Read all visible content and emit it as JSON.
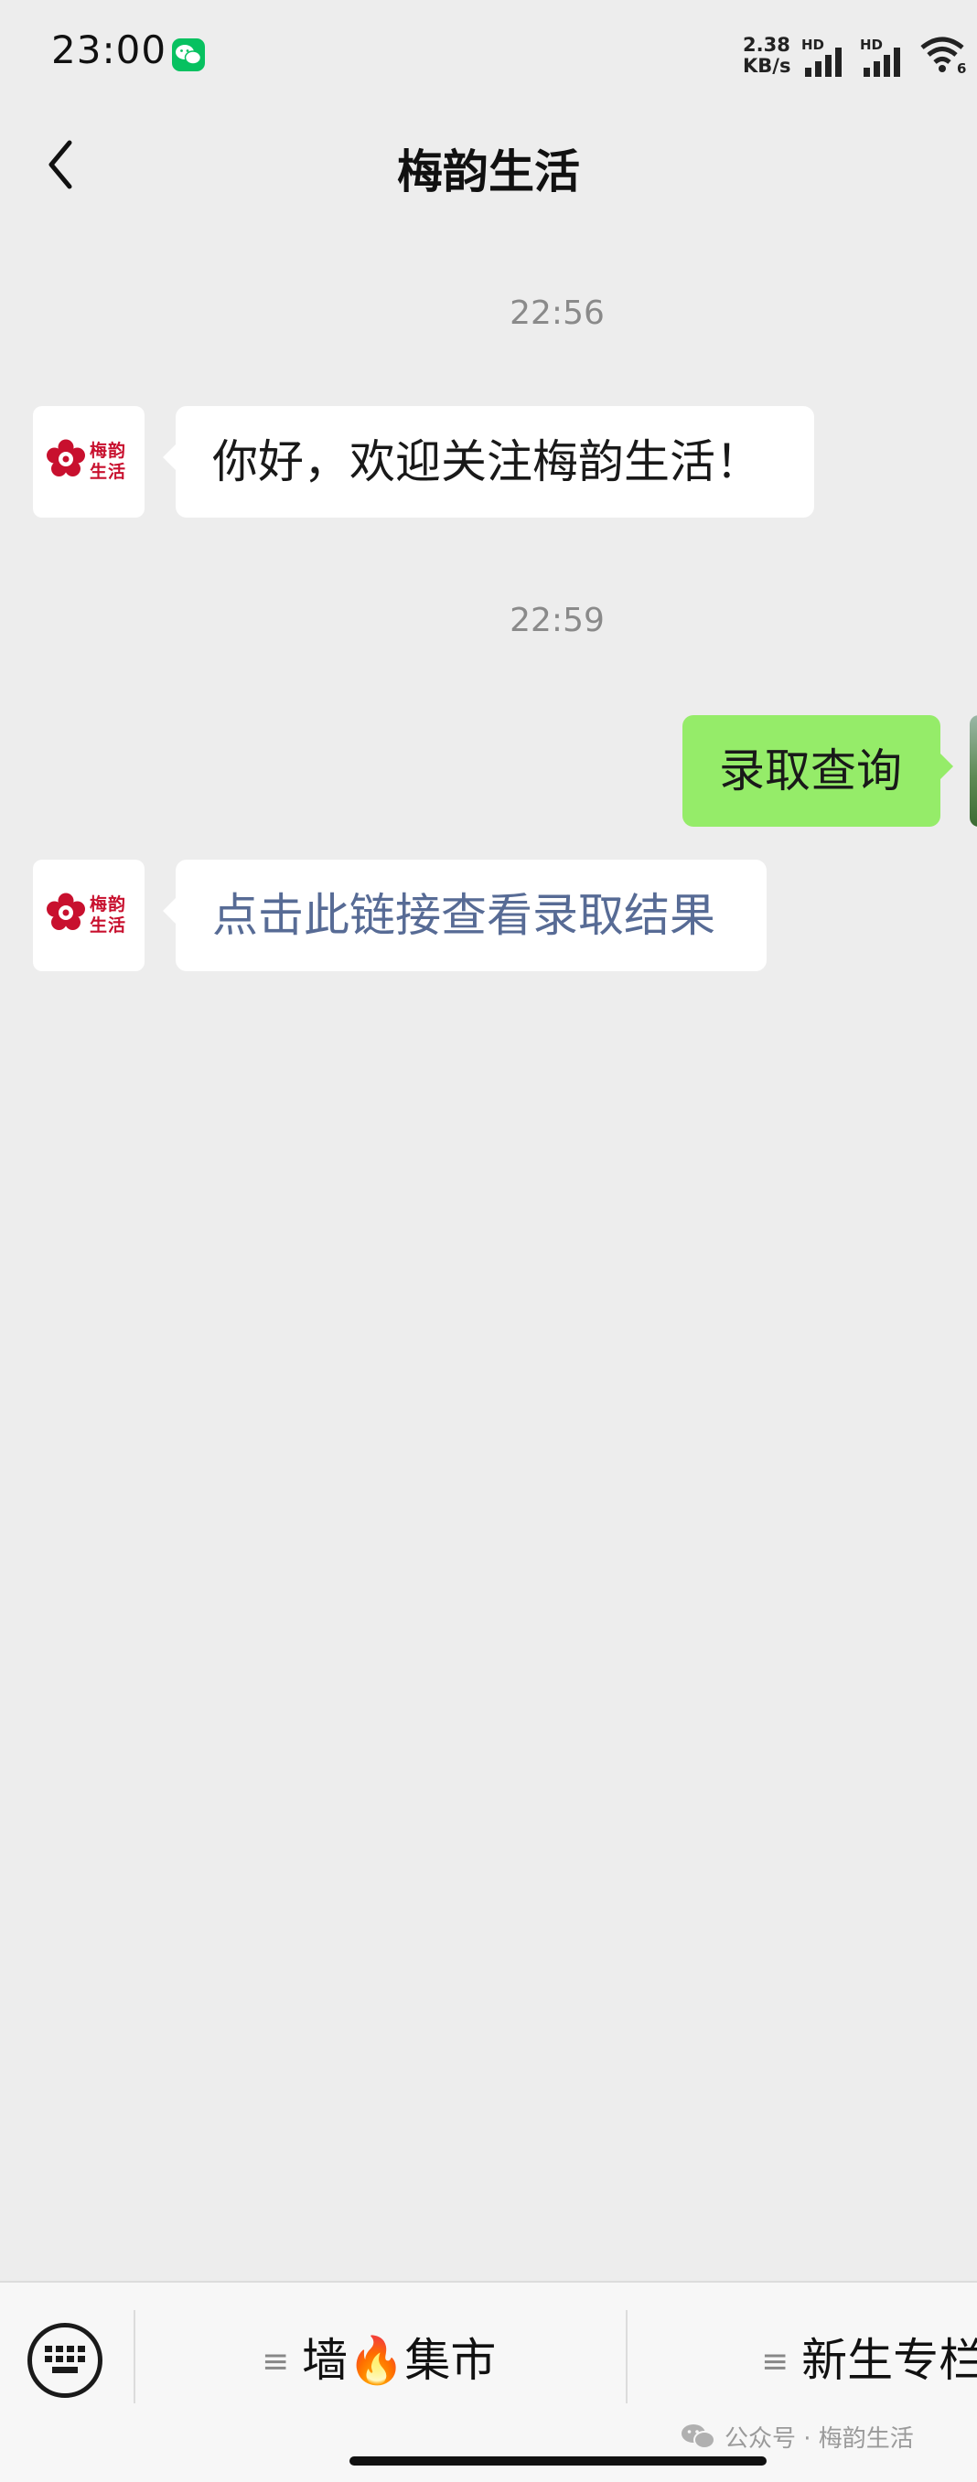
{
  "status_bar": {
    "time": "23:00",
    "net_speed_value": "2.38",
    "net_speed_unit": "KB/s",
    "signal1_label": "HD",
    "signal2_label": "HD",
    "wifi_badge": "6"
  },
  "header": {
    "title": "梅韵生活"
  },
  "avatar_logo": {
    "line1": "梅韵",
    "line2": "生活"
  },
  "messages": [
    {
      "timestamp": "22:56"
    },
    {
      "direction": "incoming",
      "text": "你好，欢迎关注梅韵生活！"
    },
    {
      "timestamp": "22:59"
    },
    {
      "direction": "outgoing",
      "text": "录取查询"
    },
    {
      "direction": "incoming",
      "text": "点击此链接查看录取结果",
      "is_link": true
    }
  ],
  "menu": {
    "items": [
      {
        "label": "墙🔥集市"
      },
      {
        "label": "新生专栏"
      }
    ]
  },
  "watermark": "公众号 · 梅韵生活"
}
